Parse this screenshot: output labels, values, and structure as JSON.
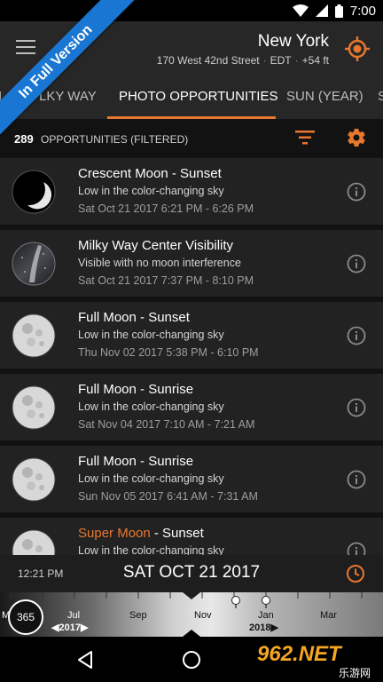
{
  "status_bar": {
    "time": "7:00"
  },
  "banner": {
    "text": "In Full Version"
  },
  "header": {
    "title": "New York",
    "address": "170 West 42nd Street",
    "timezone": "EDT",
    "elevation": "+54 ft",
    "menu_icon": "hamburger-icon",
    "location_icon": "target-icon"
  },
  "tabs": [
    {
      "label": "I"
    },
    {
      "label": "LKY WAY"
    },
    {
      "label": "PHOTO OPPORTUNITIES",
      "active": true
    },
    {
      "label": "SUN (YEAR)"
    },
    {
      "label": "S"
    }
  ],
  "filter_bar": {
    "count": "289",
    "label": "OPPORTUNITIES (FILTERED)",
    "accent_color": "#e8772e"
  },
  "opportunities": [
    {
      "title": "Crescent Moon - Sunset",
      "desc": "Low in the color-changing sky",
      "time": "Sat Oct 21 2017 6:21 PM - 6:26 PM",
      "thumb": "crescent-moon"
    },
    {
      "title": "Milky Way Center Visibility",
      "desc": "Visible with no moon interference",
      "time": "Sat Oct 21 2017 7:37 PM - 8:10 PM",
      "thumb": "milky-way"
    },
    {
      "title": "Full Moon - Sunset",
      "desc": "Low in the color-changing sky",
      "time": "Thu Nov 02 2017 5:38 PM - 6:10 PM",
      "thumb": "full-moon"
    },
    {
      "title": "Full Moon - Sunrise",
      "desc": "Low in the color-changing sky",
      "time": "Sat Nov 04 2017 7:10 AM - 7:21 AM",
      "thumb": "full-moon"
    },
    {
      "title": "Full Moon - Sunrise",
      "desc": "Low in the color-changing sky",
      "time": "Sun Nov 05 2017 6:41 AM - 7:31 AM",
      "thumb": "full-moon"
    },
    {
      "title_highlight": "Super Moon",
      "title_rest": " - Sunset",
      "desc": "Low in the color-changing sky",
      "time": "",
      "thumb": "full-moon"
    }
  ],
  "time_bar": {
    "time": "12:21 PM",
    "date": "SAT OCT 21 2017"
  },
  "timeline": {
    "badge": "365",
    "months": [
      "M",
      "Jul",
      "Sep",
      "Nov",
      "Jan",
      "Mar"
    ],
    "year_left": "2017",
    "year_right": "2018"
  },
  "watermark": {
    "main": "962.NET",
    "sub": "乐游网"
  }
}
